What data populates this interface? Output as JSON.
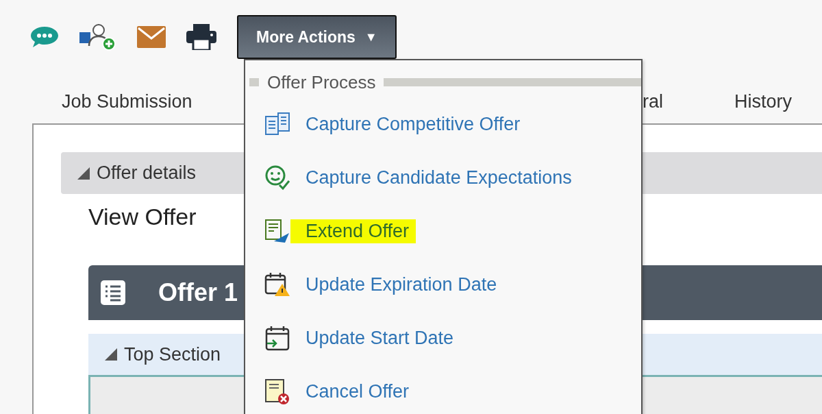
{
  "toolbar": {
    "more_actions": {
      "label": "More Actions",
      "caret": "▼"
    }
  },
  "tabs": [
    {
      "label": "Job Submission"
    },
    {
      "label": "ral"
    },
    {
      "label": "History"
    }
  ],
  "menu": {
    "section": "Offer Process",
    "items": [
      {
        "label": "Capture Competitive Offer",
        "kind": "competitive",
        "highlighted": false
      },
      {
        "label": "Capture Candidate Expectations",
        "kind": "expectations",
        "highlighted": false
      },
      {
        "label": "Extend Offer",
        "kind": "extend",
        "highlighted": true
      },
      {
        "label": "Update Expiration Date",
        "kind": "expiration",
        "highlighted": false
      },
      {
        "label": "Update Start Date",
        "kind": "start",
        "highlighted": false
      },
      {
        "label": "Cancel Offer",
        "kind": "cancel",
        "highlighted": false
      }
    ]
  },
  "panel": {
    "section_title": "Offer details",
    "heading": "View Offer",
    "offer_title": "Offer 1",
    "subsection": "Top Section"
  }
}
